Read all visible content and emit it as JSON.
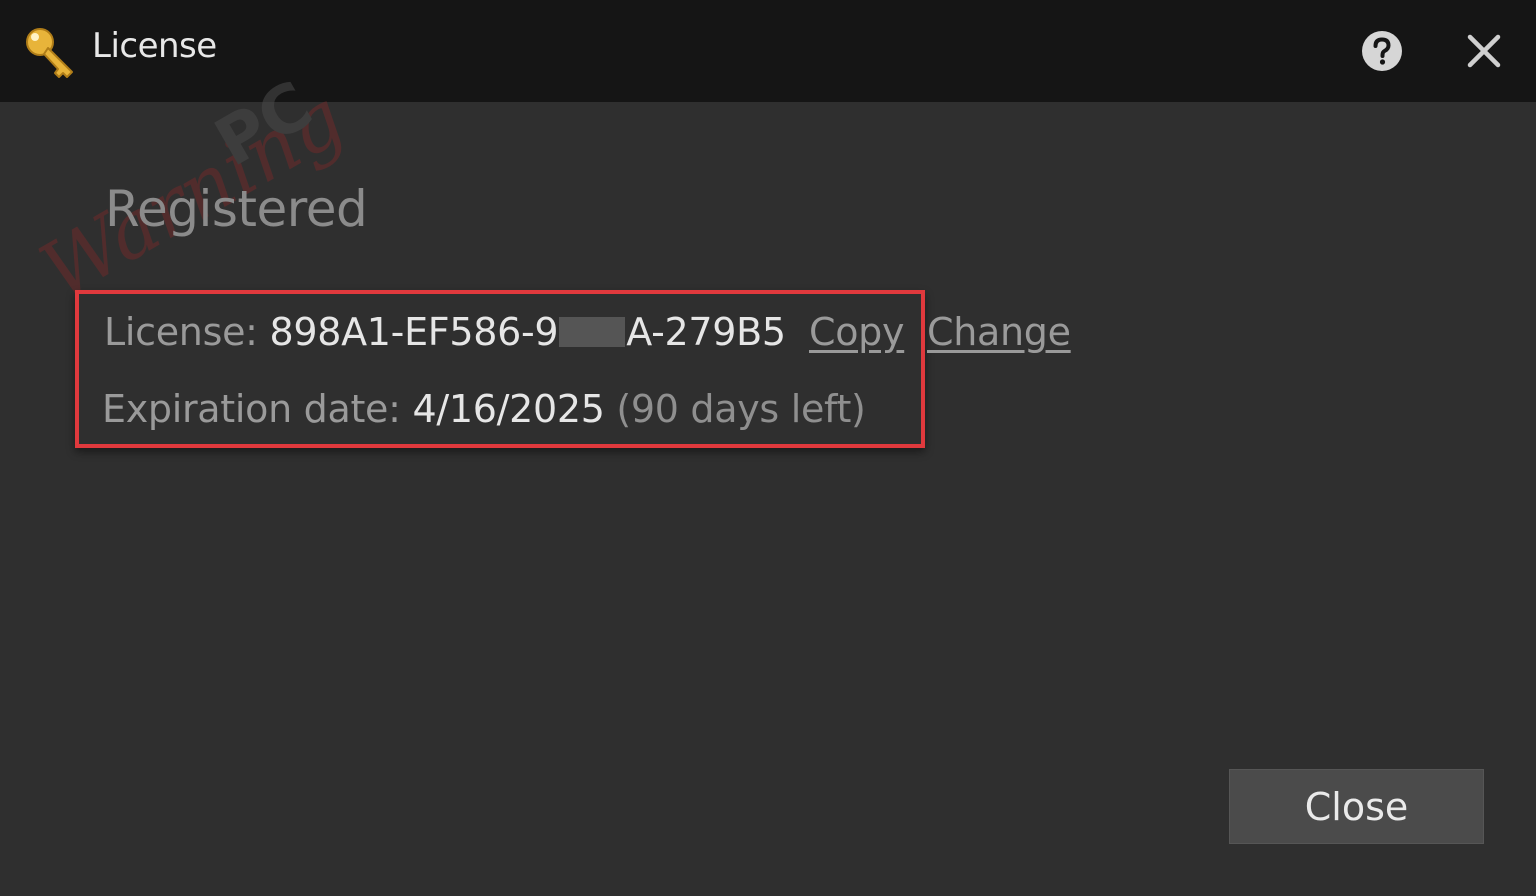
{
  "window": {
    "title": "License",
    "title_icon": "key-icon",
    "help_icon": "help-icon",
    "close_icon": "close-icon"
  },
  "watermark": {
    "script_text": "Warning",
    "block_text": "PC"
  },
  "status": {
    "heading": "Registered"
  },
  "license": {
    "label": "License:",
    "key_prefix": "898A1-EF586-9",
    "key_suffix": "A-279B5",
    "copy_label": "Copy",
    "change_label": "Change"
  },
  "expiration": {
    "label": "Expiration date:",
    "date": "4/16/2025",
    "remaining": "(90 days left)"
  },
  "footer": {
    "close_label": "Close"
  },
  "colors": {
    "title_bar": "#151515",
    "background": "#2f2f2f",
    "highlight_border": "#e0393d",
    "key_icon": "#e8b43a",
    "watermark_red": "#6e2b2b"
  }
}
